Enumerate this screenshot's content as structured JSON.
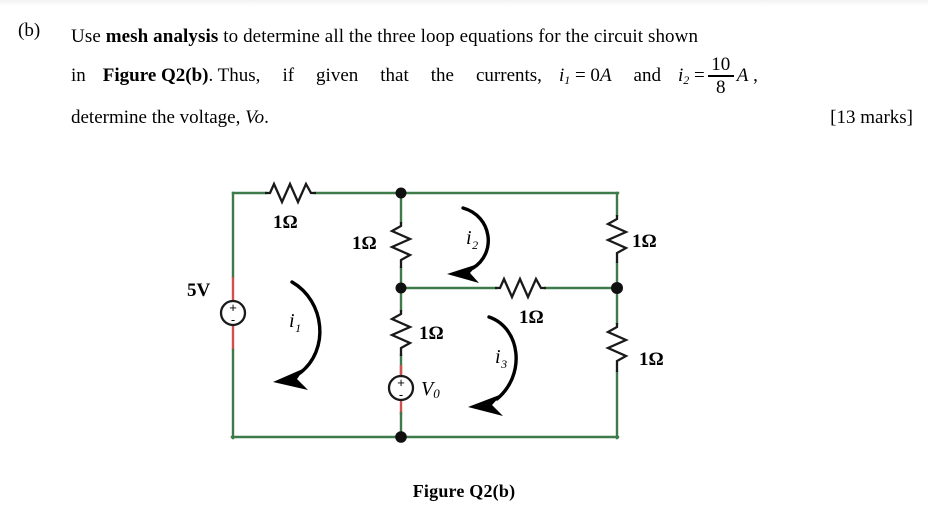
{
  "question": {
    "label": "(b)",
    "line1": {
      "pre": "Use ",
      "bold": "mesh analysis",
      "post": " to determine all the three loop equations for the circuit shown"
    },
    "line2": {
      "w1": "in",
      "figure_ref": "Figure Q2(b)",
      "w2": ". Thus,",
      "w3": "if",
      "w4": "given",
      "w5": "that",
      "w6": "the",
      "w7": "currents,",
      "eq1_var": "i",
      "eq1_sub": "1",
      "eq1_rhs": "= 0",
      "eq1_unit": "A",
      "conj": "and",
      "eq2_var": "i",
      "eq2_sub": "2",
      "eq2_eq": "=",
      "eq2_num": "10",
      "eq2_den": "8",
      "eq2_unit": "A",
      "comma": ","
    },
    "line3": {
      "text_pre": "determine the voltage, ",
      "vo": "Vo",
      "period": ".",
      "marks": "[13 marks]"
    }
  },
  "figure": {
    "caption": "Figure Q2(b)",
    "wire_color": "#3f7a4a",
    "terminal_color": "#d0504f",
    "component_color": "#1a1a1a",
    "sources": [
      {
        "name": "voltage-source-5v",
        "label": "5V",
        "plus": "+",
        "minus": "-"
      },
      {
        "name": "voltage-source-vo",
        "label": "Vo",
        "plus": "+",
        "minus": "-"
      }
    ],
    "resistors": [
      {
        "name": "resistor-top-left",
        "label": "1Ω",
        "orientation": "horizontal"
      },
      {
        "name": "resistor-middle-upper",
        "label": "1Ω",
        "orientation": "vertical"
      },
      {
        "name": "resistor-middle-lower",
        "label": "1Ω",
        "orientation": "vertical"
      },
      {
        "name": "resistor-center-horizontal",
        "label": "1Ω",
        "orientation": "horizontal"
      },
      {
        "name": "resistor-right-upper",
        "label": "1Ω",
        "orientation": "vertical"
      },
      {
        "name": "resistor-right-lower",
        "label": "1Ω",
        "orientation": "vertical"
      }
    ],
    "mesh_currents": [
      {
        "name": "mesh-current-i1",
        "symbol": "i",
        "subscript": "1"
      },
      {
        "name": "mesh-current-i2",
        "symbol": "i",
        "subscript": "2"
      },
      {
        "name": "mesh-current-i3",
        "symbol": "i",
        "subscript": "3"
      }
    ]
  }
}
